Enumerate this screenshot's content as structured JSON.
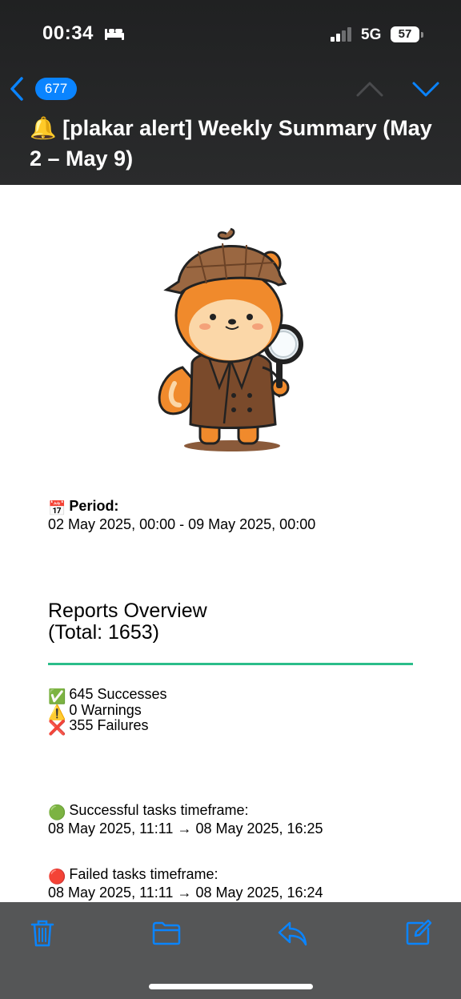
{
  "status_bar": {
    "time": "00:34",
    "focus_icon": "bed-icon",
    "network": "5G",
    "battery_level": "57"
  },
  "nav": {
    "back_count": "677",
    "prev_icon": "chevron-up-icon",
    "next_icon": "chevron-down-icon"
  },
  "email": {
    "subject": "🔔 [plakar alert] Weekly Summary (May 2 – May 9)",
    "period_emoji": "📅",
    "period_label": "Period:",
    "period_value": "02 May 2025, 00:00 - 09 May 2025, 00:00",
    "overview_title": "Reports Overview",
    "overview_total": "(Total: 1653)",
    "stats": [
      {
        "emoji": "✅",
        "text": "645 Successes"
      },
      {
        "emoji": "⚠️",
        "text": "0 Warnings"
      },
      {
        "emoji": "❌",
        "text": "355 Failures"
      }
    ],
    "success_timeframe_emoji": "🟢",
    "success_timeframe_label": "Successful tasks timeframe:",
    "success_timeframe_value": "08 May 2025, 11:11 → 08 May 2025, 16:25",
    "failed_timeframe_emoji": "🔴",
    "failed_timeframe_label": "Failed tasks timeframe:",
    "failed_timeframe_value": "08 May 2025, 11:11 → 08 May 2025, 16:24"
  },
  "toolbar": {
    "icons": [
      "trash-icon",
      "folder-icon",
      "reply-icon",
      "compose-icon"
    ]
  },
  "colors": {
    "accent": "#0a84ff",
    "divider": "#2bbd8a",
    "header_bg": "#202122",
    "toolbar_bg": "#555657"
  }
}
